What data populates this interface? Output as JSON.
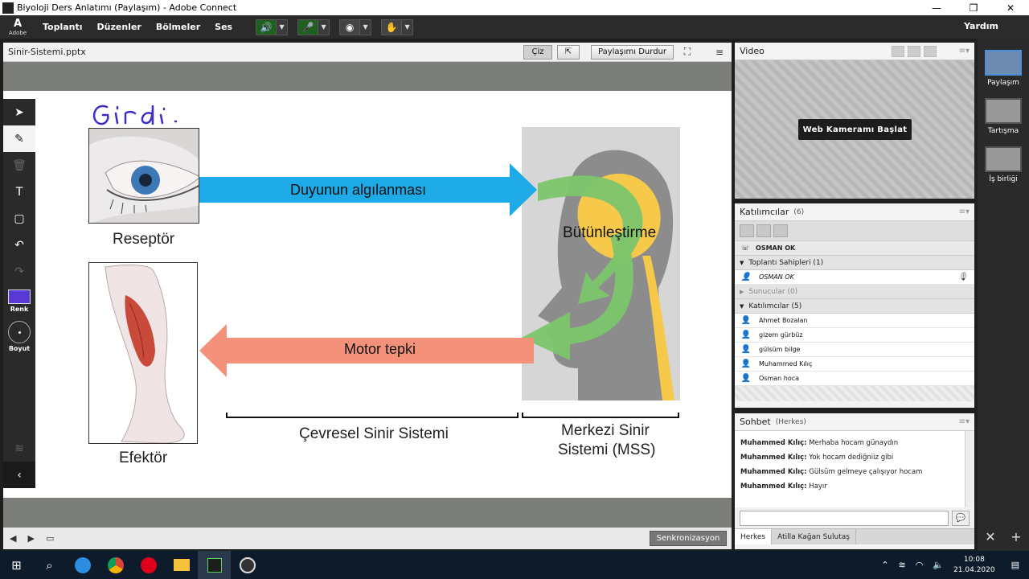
{
  "window": {
    "title": "Biyoloji Ders Anlatımı (Paylaşım) - Adobe Connect",
    "minimize": "—",
    "maximize": "❐",
    "close": "✕"
  },
  "menubar": {
    "logo_letter": "A",
    "logo_text": "Adobe",
    "items": [
      "Toplantı",
      "Düzenler",
      "Bölmeler",
      "Ses"
    ],
    "help": "Yardım"
  },
  "share_pod": {
    "title": "Sinir-Sistemi.pptx",
    "draw_button": "Çiz",
    "stop_sharing_button": "Paylaşımı Durdur",
    "sync_button": "Senkronizasyon"
  },
  "toolbar": {
    "color_label": "Renk",
    "size_label": "Boyut",
    "color": "#5a3ad4"
  },
  "slide": {
    "handwritten": "Girdi",
    "receptor_label": "Reseptör",
    "effector_label": "Efektör",
    "perception_arrow": "Duyunun algılanması",
    "integration_label": "Bütünleştirme",
    "motor_arrow": "Motor tepki",
    "pns_label": "Çevresel Sinir Sistemi",
    "cns_label_line1": "Merkezi Sinir",
    "cns_label_line2": "Sistemi (MSS)",
    "colors": {
      "sensory_arrow": "#1eaae6",
      "motor_arrow": "#f3917a",
      "integration_arrow": "#7cc56b",
      "head": "#8c8c8c",
      "brain": "#f6c94a"
    }
  },
  "video_pod": {
    "title": "Video",
    "webcam_button": "Web Kameramı Başlat"
  },
  "attendees_pod": {
    "title": "Katılımcılar",
    "count": "(6)",
    "current_user": "OSMAN OK",
    "hosts_group": "Toplantı Sahipleri (1)",
    "hosts": [
      "OSMAN OK"
    ],
    "presenters_group": "Sunucular (0)",
    "participants_group": "Katılımcılar (5)",
    "participants": [
      "Ahmet Bozalan",
      "gizem gürbüz",
      "gülsüm bilge",
      "Muhammed Kılıç",
      "Osman hoca"
    ]
  },
  "chat_pod": {
    "title": "Sohbet",
    "scope": "(Herkes)",
    "messages": [
      {
        "who": "Muhammed Kılıç:",
        "text": "Merhaba hocam günaydın"
      },
      {
        "who": "Muhammed Kılıç:",
        "text": "Yok hocam dediğniiz gibi"
      },
      {
        "who": "Muhammed Kılıç:",
        "text": "Gülsüm gelmeye çalışıyor hocam"
      },
      {
        "who": "Muhammed Kılıç:",
        "text": "Hayır"
      }
    ],
    "tabs": [
      "Herkes",
      "Atilla Kağan Sulutaş"
    ]
  },
  "layouts": {
    "items": [
      "Paylaşım",
      "Tartışma",
      "İş birliği"
    ]
  },
  "taskbar": {
    "time": "10:08",
    "date": "21.04.2020",
    "lang_icon": "≋"
  }
}
